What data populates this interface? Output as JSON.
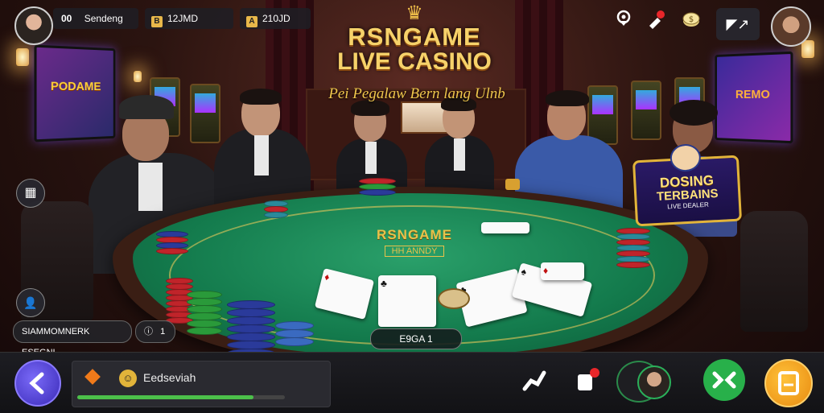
{
  "colors": {
    "accent_gold": "#f6d26a",
    "felt_green": "#137a4c",
    "bar_fill": "#4cc04a",
    "chat_green": "#28b04a",
    "gift_orange": "#f0a21a"
  },
  "top_left": {
    "player_avatar_icon": "user-avatar-icon",
    "username_pill": {
      "count": "00",
      "text": "Sendeng"
    },
    "balance_pill": {
      "icon_glyph": "B",
      "text": "12JMD"
    },
    "coins_pill": {
      "icon_glyph": "A",
      "text": "210JD"
    }
  },
  "title": {
    "line1": "RSNGAME",
    "line2": "LIVE CASINO",
    "subtitle": "Pei Pegalaw Bern lang Ulnb"
  },
  "top_right_icons": [
    "location-pin-icon",
    "rocket-icon",
    "cash-icon",
    "fullscreen-icon"
  ],
  "top_right": {
    "settings_glyph": "◤↗"
  },
  "tv_left": {
    "text": "PODAME"
  },
  "tv_right": {
    "text": "REMO"
  },
  "felt": {
    "logo": "RSNGAME",
    "sublogo": "HH ANNDY"
  },
  "promo": {
    "line1": "DOSING",
    "line2": "TERBAINS",
    "line3": "LIVE DEALER"
  },
  "bet_label": "E9GA 1",
  "left_controls": {
    "table_button_glyph": "▦",
    "profile_button_glyph": "👤",
    "ticker_text": "SIAMMOMNERK ESEGNI",
    "info_count": "1",
    "info_glyph": "ⓘ"
  },
  "cards": [
    {
      "rank": "♦",
      "cls": "red"
    },
    {
      "rank": "♣",
      "cls": ""
    },
    {
      "rank": "♣",
      "cls": ""
    },
    {
      "rank": "♠",
      "cls": ""
    },
    {
      "rank": "♦",
      "cls": "red"
    }
  ],
  "bottom": {
    "player_name": "Eedseviah",
    "coin_glyph": "☺",
    "progress": 0.85,
    "buttons": [
      "gesture-icon",
      "clap-icon",
      "avatar-icon",
      "chat-icon",
      "gift-icon"
    ]
  }
}
